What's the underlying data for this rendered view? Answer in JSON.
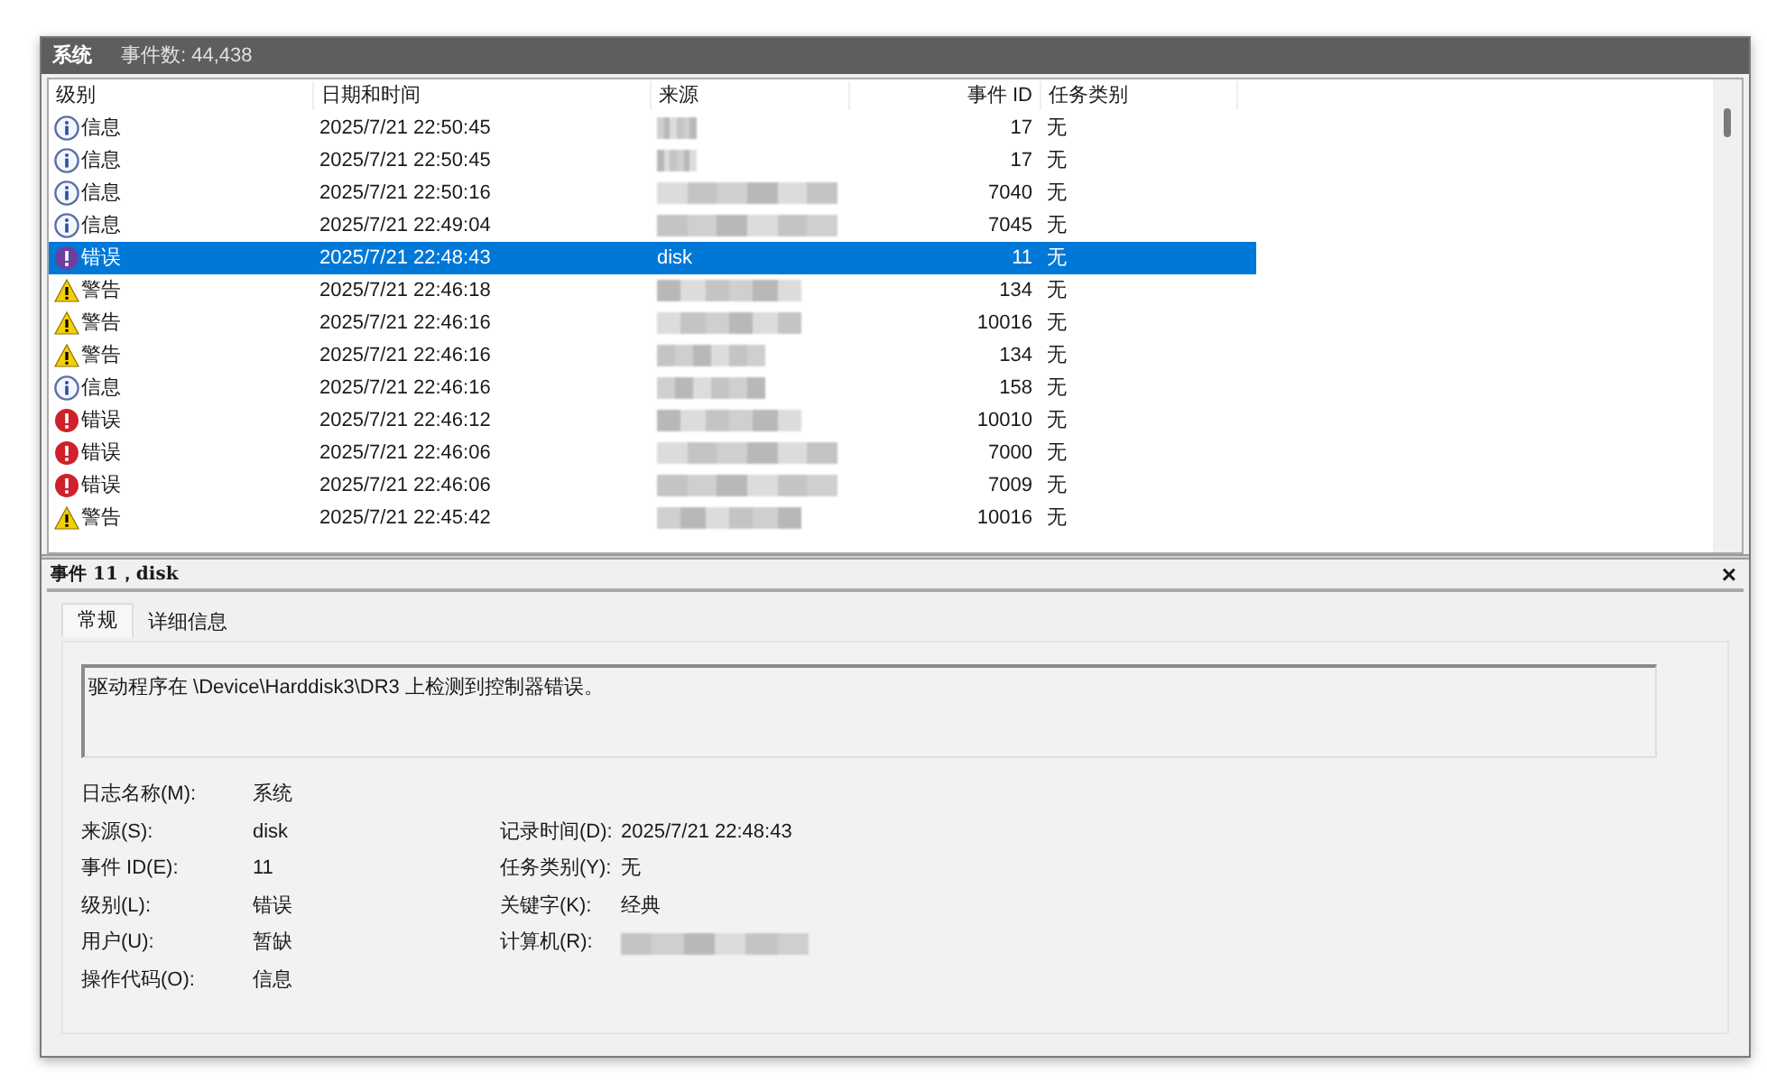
{
  "window": {
    "title": "系统",
    "event_count": "事件数: 44,438"
  },
  "table": {
    "columns": [
      "级别",
      "日期和时间",
      "来源",
      "事件 ID",
      "任务类别"
    ],
    "rows": [
      {
        "kind": "info",
        "level_text": "信息",
        "date": "2025/7/21 22:50:45",
        "source": {
          "blurred": true
        },
        "id": "17",
        "task": "无",
        "selected": false
      },
      {
        "kind": "info",
        "level_text": "信息",
        "date": "2025/7/21 22:50:45",
        "source": {
          "blurred": true
        },
        "id": "17",
        "task": "无",
        "selected": false
      },
      {
        "kind": "info",
        "level_text": "信息",
        "date": "2025/7/21 22:50:16",
        "source": {
          "blurred": true
        },
        "id": "7040",
        "task": "无",
        "selected": false
      },
      {
        "kind": "info",
        "level_text": "信息",
        "date": "2025/7/21 22:49:04",
        "source": {
          "blurred": true
        },
        "id": "7045",
        "task": "无",
        "selected": false
      },
      {
        "kind": "error",
        "level_text": "错误",
        "date": "2025/7/21 22:48:43",
        "source": {
          "blurred": false,
          "text": "disk"
        },
        "id": "11",
        "task": "无",
        "selected": true
      },
      {
        "kind": "warning",
        "level_text": "警告",
        "date": "2025/7/21 22:46:18",
        "source": {
          "blurred": true
        },
        "id": "134",
        "task": "无",
        "selected": false
      },
      {
        "kind": "warning",
        "level_text": "警告",
        "date": "2025/7/21 22:46:16",
        "source": {
          "blurred": true
        },
        "id": "10016",
        "task": "无",
        "selected": false
      },
      {
        "kind": "warning",
        "level_text": "警告",
        "date": "2025/7/21 22:46:16",
        "source": {
          "blurred": true
        },
        "id": "134",
        "task": "无",
        "selected": false
      },
      {
        "kind": "info",
        "level_text": "信息",
        "date": "2025/7/21 22:46:16",
        "source": {
          "blurred": true
        },
        "id": "158",
        "task": "无",
        "selected": false
      },
      {
        "kind": "error",
        "level_text": "错误",
        "date": "2025/7/21 22:46:12",
        "source": {
          "blurred": true
        },
        "id": "10010",
        "task": "无",
        "selected": false
      },
      {
        "kind": "error",
        "level_text": "错误",
        "date": "2025/7/21 22:46:06",
        "source": {
          "blurred": true
        },
        "id": "7000",
        "task": "无",
        "selected": false
      },
      {
        "kind": "error",
        "level_text": "错误",
        "date": "2025/7/21 22:46:06",
        "source": {
          "blurred": true
        },
        "id": "7009",
        "task": "无",
        "selected": false
      },
      {
        "kind": "warning",
        "level_text": "警告",
        "date": "2025/7/21 22:45:42",
        "source": {
          "blurred": true
        },
        "id": "10016",
        "task": "无",
        "selected": false
      }
    ]
  },
  "detail": {
    "title": "事件 11，disk",
    "close": "×",
    "tabs": [
      {
        "label": "常规",
        "selected": true
      },
      {
        "label": "详细信息",
        "selected": false
      }
    ],
    "message": "驱动程序在 \\Device\\Harddisk3\\DR3 上检测到控制器错误。",
    "left_fields": [
      {
        "label": "日志名称(M):",
        "value": "系统"
      },
      {
        "label": "来源(S):",
        "value": "disk"
      },
      {
        "label": "事件 ID(E):",
        "value": "11"
      },
      {
        "label": "级别(L):",
        "value": "错误"
      },
      {
        "label": "用户(U):",
        "value": "暂缺"
      },
      {
        "label": "操作代码(O):",
        "value": "信息"
      }
    ],
    "right_fields": [
      {
        "label": "记录时间(D):",
        "value": "2025/7/21 22:48:43"
      },
      {
        "label": "任务类别(Y):",
        "value": "无"
      },
      {
        "label": "关键字(K):",
        "value": "经典"
      },
      {
        "label": "计算机(R):",
        "blurred": true
      }
    ]
  }
}
